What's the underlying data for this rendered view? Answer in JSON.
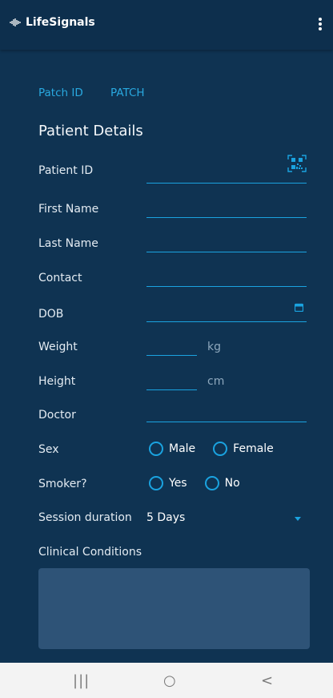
{
  "app": {
    "title": "LifeSignals",
    "logo_icon": "waveform-icon",
    "menu_icon": "more-vert-icon"
  },
  "patch": {
    "label": "Patch ID",
    "value": "PATCH"
  },
  "section": {
    "title": "Patient Details"
  },
  "fields": {
    "patient_id": {
      "label": "Patient ID",
      "value": "",
      "icon": "qr-scan-icon"
    },
    "first_name": {
      "label": "First Name",
      "value": ""
    },
    "last_name": {
      "label": "Last Name",
      "value": ""
    },
    "contact": {
      "label": "Contact",
      "value": ""
    },
    "dob": {
      "label": "DOB",
      "value": "",
      "icon": "calendar-icon"
    },
    "weight": {
      "label": "Weight",
      "value": "",
      "unit": "kg"
    },
    "height": {
      "label": "Height",
      "value": "",
      "unit": "cm"
    },
    "doctor": {
      "label": "Doctor",
      "value": ""
    }
  },
  "sex": {
    "label": "Sex",
    "options": [
      "Male",
      "Female"
    ]
  },
  "smoker": {
    "label": "Smoker?",
    "options": [
      "Yes",
      "No"
    ]
  },
  "session": {
    "label": "Session duration",
    "value": "5 Days"
  },
  "clinical": {
    "label": "Clinical Conditions",
    "value": ""
  },
  "navbar": {
    "recents_glyph": "|||",
    "home_glyph": "○",
    "back_glyph": "<"
  },
  "colors": {
    "background": "#0f3352",
    "accent": "#1aa3e0",
    "text_area": "#2e5377",
    "nav_bar": "#f3f3f3"
  }
}
